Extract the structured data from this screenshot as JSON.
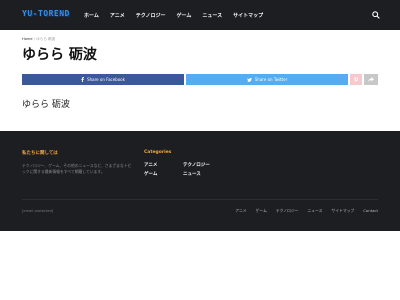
{
  "header": {
    "logo_text": "YU-TOREND",
    "nav": [
      "ホーム",
      "アニメ",
      "テクノロジー",
      "ゲーム",
      "ニュース",
      "サイトマップ"
    ],
    "search_icon": "search-icon"
  },
  "breadcrumb": {
    "home": "Home",
    "separator": "/",
    "current": "ゆらら 砺波"
  },
  "article": {
    "title": "ゆらら 砺波",
    "body": "ゆらら 砺波"
  },
  "share": {
    "facebook": "Share on Facebook",
    "twitter": "Share on Twitter",
    "pinterest_icon": "pinterest-icon",
    "more_icon": "share-arrow-icon"
  },
  "footer": {
    "about_title": "私たちに関しては",
    "about_text": "テクノロジー、ゲーム、その他のニュースなど、さまざまなトピックに関する最新情報をすべて網羅しています。",
    "categories_title": "Categories",
    "categories": [
      "アニメ",
      "テクノロジー",
      "ゲーム",
      "ニュース"
    ],
    "email": "[email protected]",
    "links": [
      "アニメ",
      "ゲーム",
      "テクノロジー",
      "ニュース",
      "サイトマップ",
      "Contact"
    ]
  },
  "colors": {
    "dark_bg": "#1d1e22",
    "accent_orange": "#f4a93c",
    "facebook": "#3b5998",
    "twitter": "#55acee",
    "logo_blue": "#3a8ee8"
  }
}
